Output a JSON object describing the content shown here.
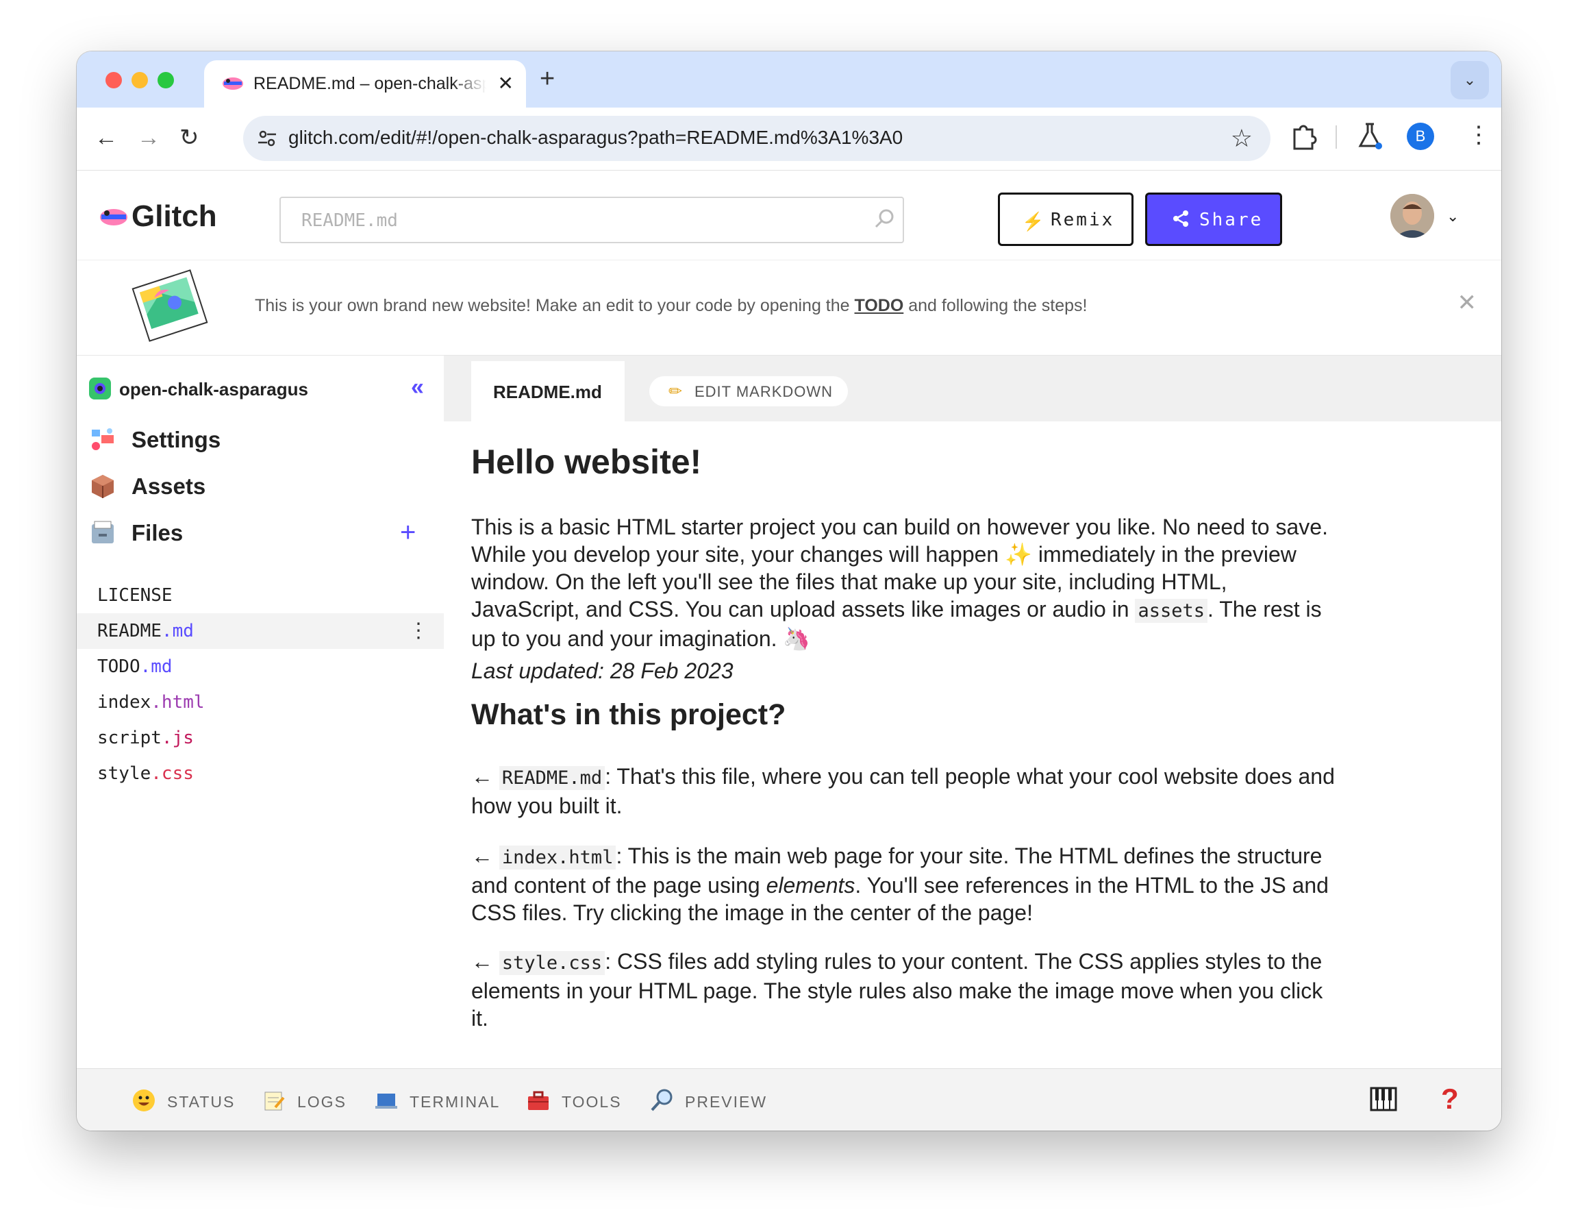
{
  "browser": {
    "tab_title": "README.md – open-chalk-asparagus",
    "new_tab": "+",
    "tab_close": "✕",
    "url": "glitch.com/edit/#!/open-chalk-asparagus?path=README.md%3A1%3A0",
    "profile_initial": "B"
  },
  "header": {
    "logo_text": "Glitch",
    "search_placeholder": "README.md",
    "remix_label": "Remix",
    "share_label": "Share"
  },
  "banner": {
    "text_before": "This is your own brand new website! Make an edit to your code by opening the ",
    "link": "TODO",
    "text_after": " and following the steps!"
  },
  "sidebar": {
    "project_name": "open-chalk-asparagus",
    "items": [
      {
        "label": "Settings",
        "icon": "settings-icon"
      },
      {
        "label": "Assets",
        "icon": "assets-box-icon"
      },
      {
        "label": "Files",
        "icon": "files-cabinet-icon"
      }
    ],
    "files": [
      {
        "name": "LICENSE",
        "ext": ""
      },
      {
        "name": "README",
        "ext": ".md"
      },
      {
        "name": "TODO",
        "ext": ".md"
      },
      {
        "name": "index",
        "ext": ".html"
      },
      {
        "name": "script",
        "ext": ".js"
      },
      {
        "name": "style",
        "ext": ".css"
      }
    ]
  },
  "editor": {
    "file_tab": "README.md",
    "edit_markdown": "EDIT MARKDOWN",
    "h1": "Hello website!",
    "p1_a": "This is a basic HTML starter project you can build on however you like. No need to save. While you develop your site, your changes will happen ",
    "p1_sparkle": "✨",
    "p1_b": " immediately in the preview window. On the left you'll see the files that make up your site, including HTML, JavaScript, and CSS. You can upload assets like images or audio in ",
    "p1_code": "assets",
    "p1_c": ". The rest is up to you and your imagination. ",
    "p1_emoji": "🦄",
    "last_updated": "Last updated: 28 Feb 2023",
    "h2": "What's in this project?",
    "item1_arrow": "←",
    "item1_code": "README.md",
    "item1_text": ": That's this file, where you can tell people what your cool website does and how you built it.",
    "item2_arrow": "←",
    "item2_code": "index.html",
    "item2_text_a": ": This is the main web page for your site. The HTML defines the structure and content of the page using ",
    "item2_em": "elements",
    "item2_text_b": ". You'll see references in the HTML to the JS and CSS files. Try clicking the image in the center of the page!",
    "item3_arrow": "←",
    "item3_code": "style.css",
    "item3_text": ": CSS files add styling rules to your content. The CSS applies styles to the elements in your HTML page. The style rules also make the image move when you click it."
  },
  "bottombar": {
    "status": "STATUS",
    "logs": "LOGS",
    "terminal": "TERMINAL",
    "tools": "TOOLS",
    "preview": "PREVIEW",
    "help": "?"
  },
  "colors": {
    "accent": "#5a4cff",
    "tabstrip": "#d3e3fd"
  }
}
